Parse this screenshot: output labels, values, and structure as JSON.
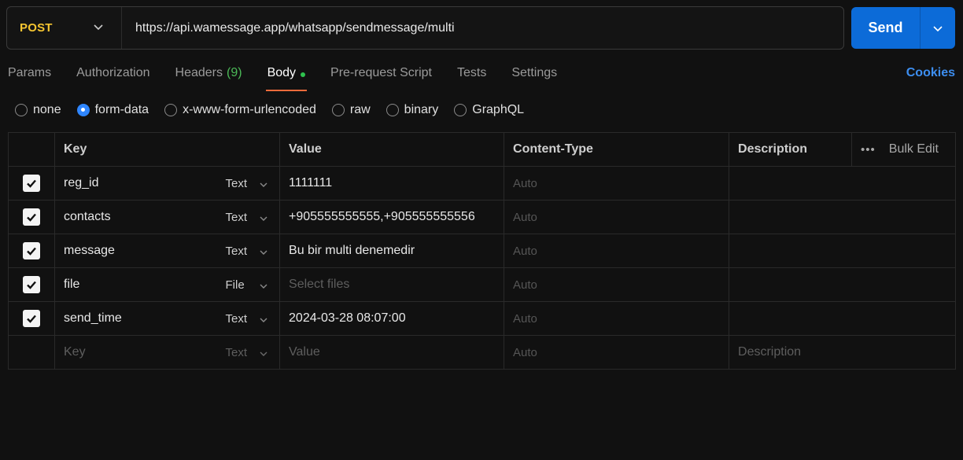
{
  "request": {
    "method": "POST",
    "url": "https://api.wamessage.app/whatsapp/sendmessage/multi",
    "send_label": "Send"
  },
  "tabs": [
    {
      "label": "Params"
    },
    {
      "label": "Authorization"
    },
    {
      "label": "Headers",
      "count": "(9)"
    },
    {
      "label": "Body",
      "active": true
    },
    {
      "label": "Pre-request Script"
    },
    {
      "label": "Tests"
    },
    {
      "label": "Settings"
    }
  ],
  "cookies_label": "Cookies",
  "body_types": [
    "none",
    "form-data",
    "x-www-form-urlencoded",
    "raw",
    "binary",
    "GraphQL"
  ],
  "selected_body_type": "form-data",
  "table": {
    "headers": {
      "key": "Key",
      "value": "Value",
      "content_type": "Content-Type",
      "description": "Description",
      "bulk_edit": "Bulk Edit"
    },
    "rows": [
      {
        "key": "reg_id",
        "type": "Text",
        "value": "1111111",
        "content_type": "Auto",
        "checked": true
      },
      {
        "key": "contacts",
        "type": "Text",
        "value": "+905555555555,+905555555556",
        "content_type": "Auto",
        "checked": true
      },
      {
        "key": "message",
        "type": "Text",
        "value": "Bu bir multi denemedir",
        "content_type": "Auto",
        "checked": true
      },
      {
        "key": "file",
        "type": "File",
        "value_placeholder": "Select files",
        "content_type": "Auto",
        "checked": true
      },
      {
        "key": "send_time",
        "type": "Text",
        "value": "2024-03-28 08:07:00",
        "content_type": "Auto",
        "checked": true
      }
    ],
    "placeholder_row": {
      "key": "Key",
      "type": "Text",
      "value": "Value",
      "content_type": "Auto",
      "description": "Description"
    }
  },
  "colors": {
    "method": "#f5c531",
    "send_button": "#0c6bd8",
    "active_tab_underline": "#ee6b3b",
    "body_dot": "#2ec24e",
    "headers_count": "#4cba58",
    "cookies_link": "#3d8ef0",
    "radio_selected": "#2f86ff"
  },
  "icons": {
    "method_dropdown": "chevron-down-icon",
    "send_dropdown": "chevron-down-icon",
    "checkbox": "checkmark-icon",
    "more": "more-horizontal-icon"
  }
}
